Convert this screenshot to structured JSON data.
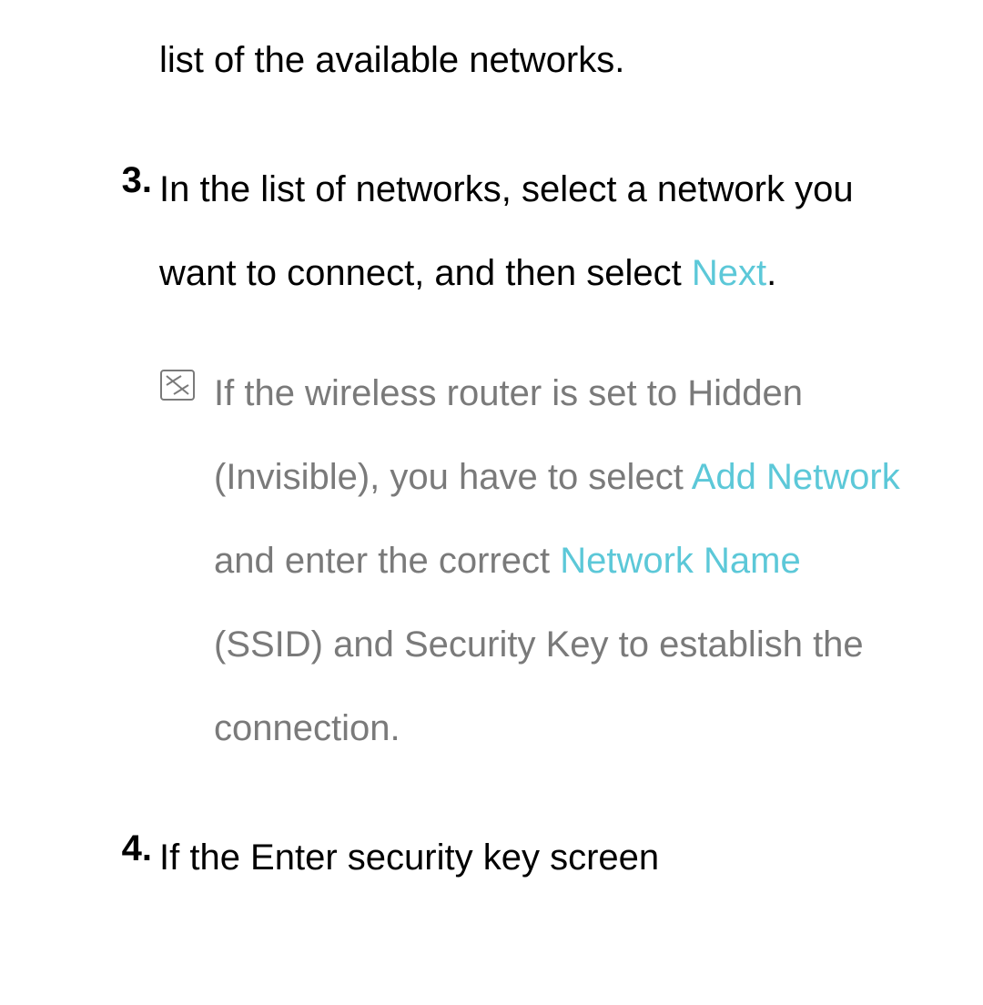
{
  "partial_line": "list of the available networks.",
  "step3": {
    "number": "3.",
    "text_before": "In the list of networks, select a network you want to connect, and then select ",
    "link1": "Next",
    "text_after": "."
  },
  "note": {
    "text1": "If the wireless router is set to Hidden (Invisible), you have to select ",
    "link1": "Add Network",
    "text2": " and enter the correct ",
    "link2": "Network Name",
    "text3": " (SSID) and Security Key to establish the connection."
  },
  "step4": {
    "number": "4.",
    "text": "If the Enter security key screen"
  },
  "colors": {
    "accent": "#5cc8d8",
    "muted": "#7a7a7a"
  }
}
